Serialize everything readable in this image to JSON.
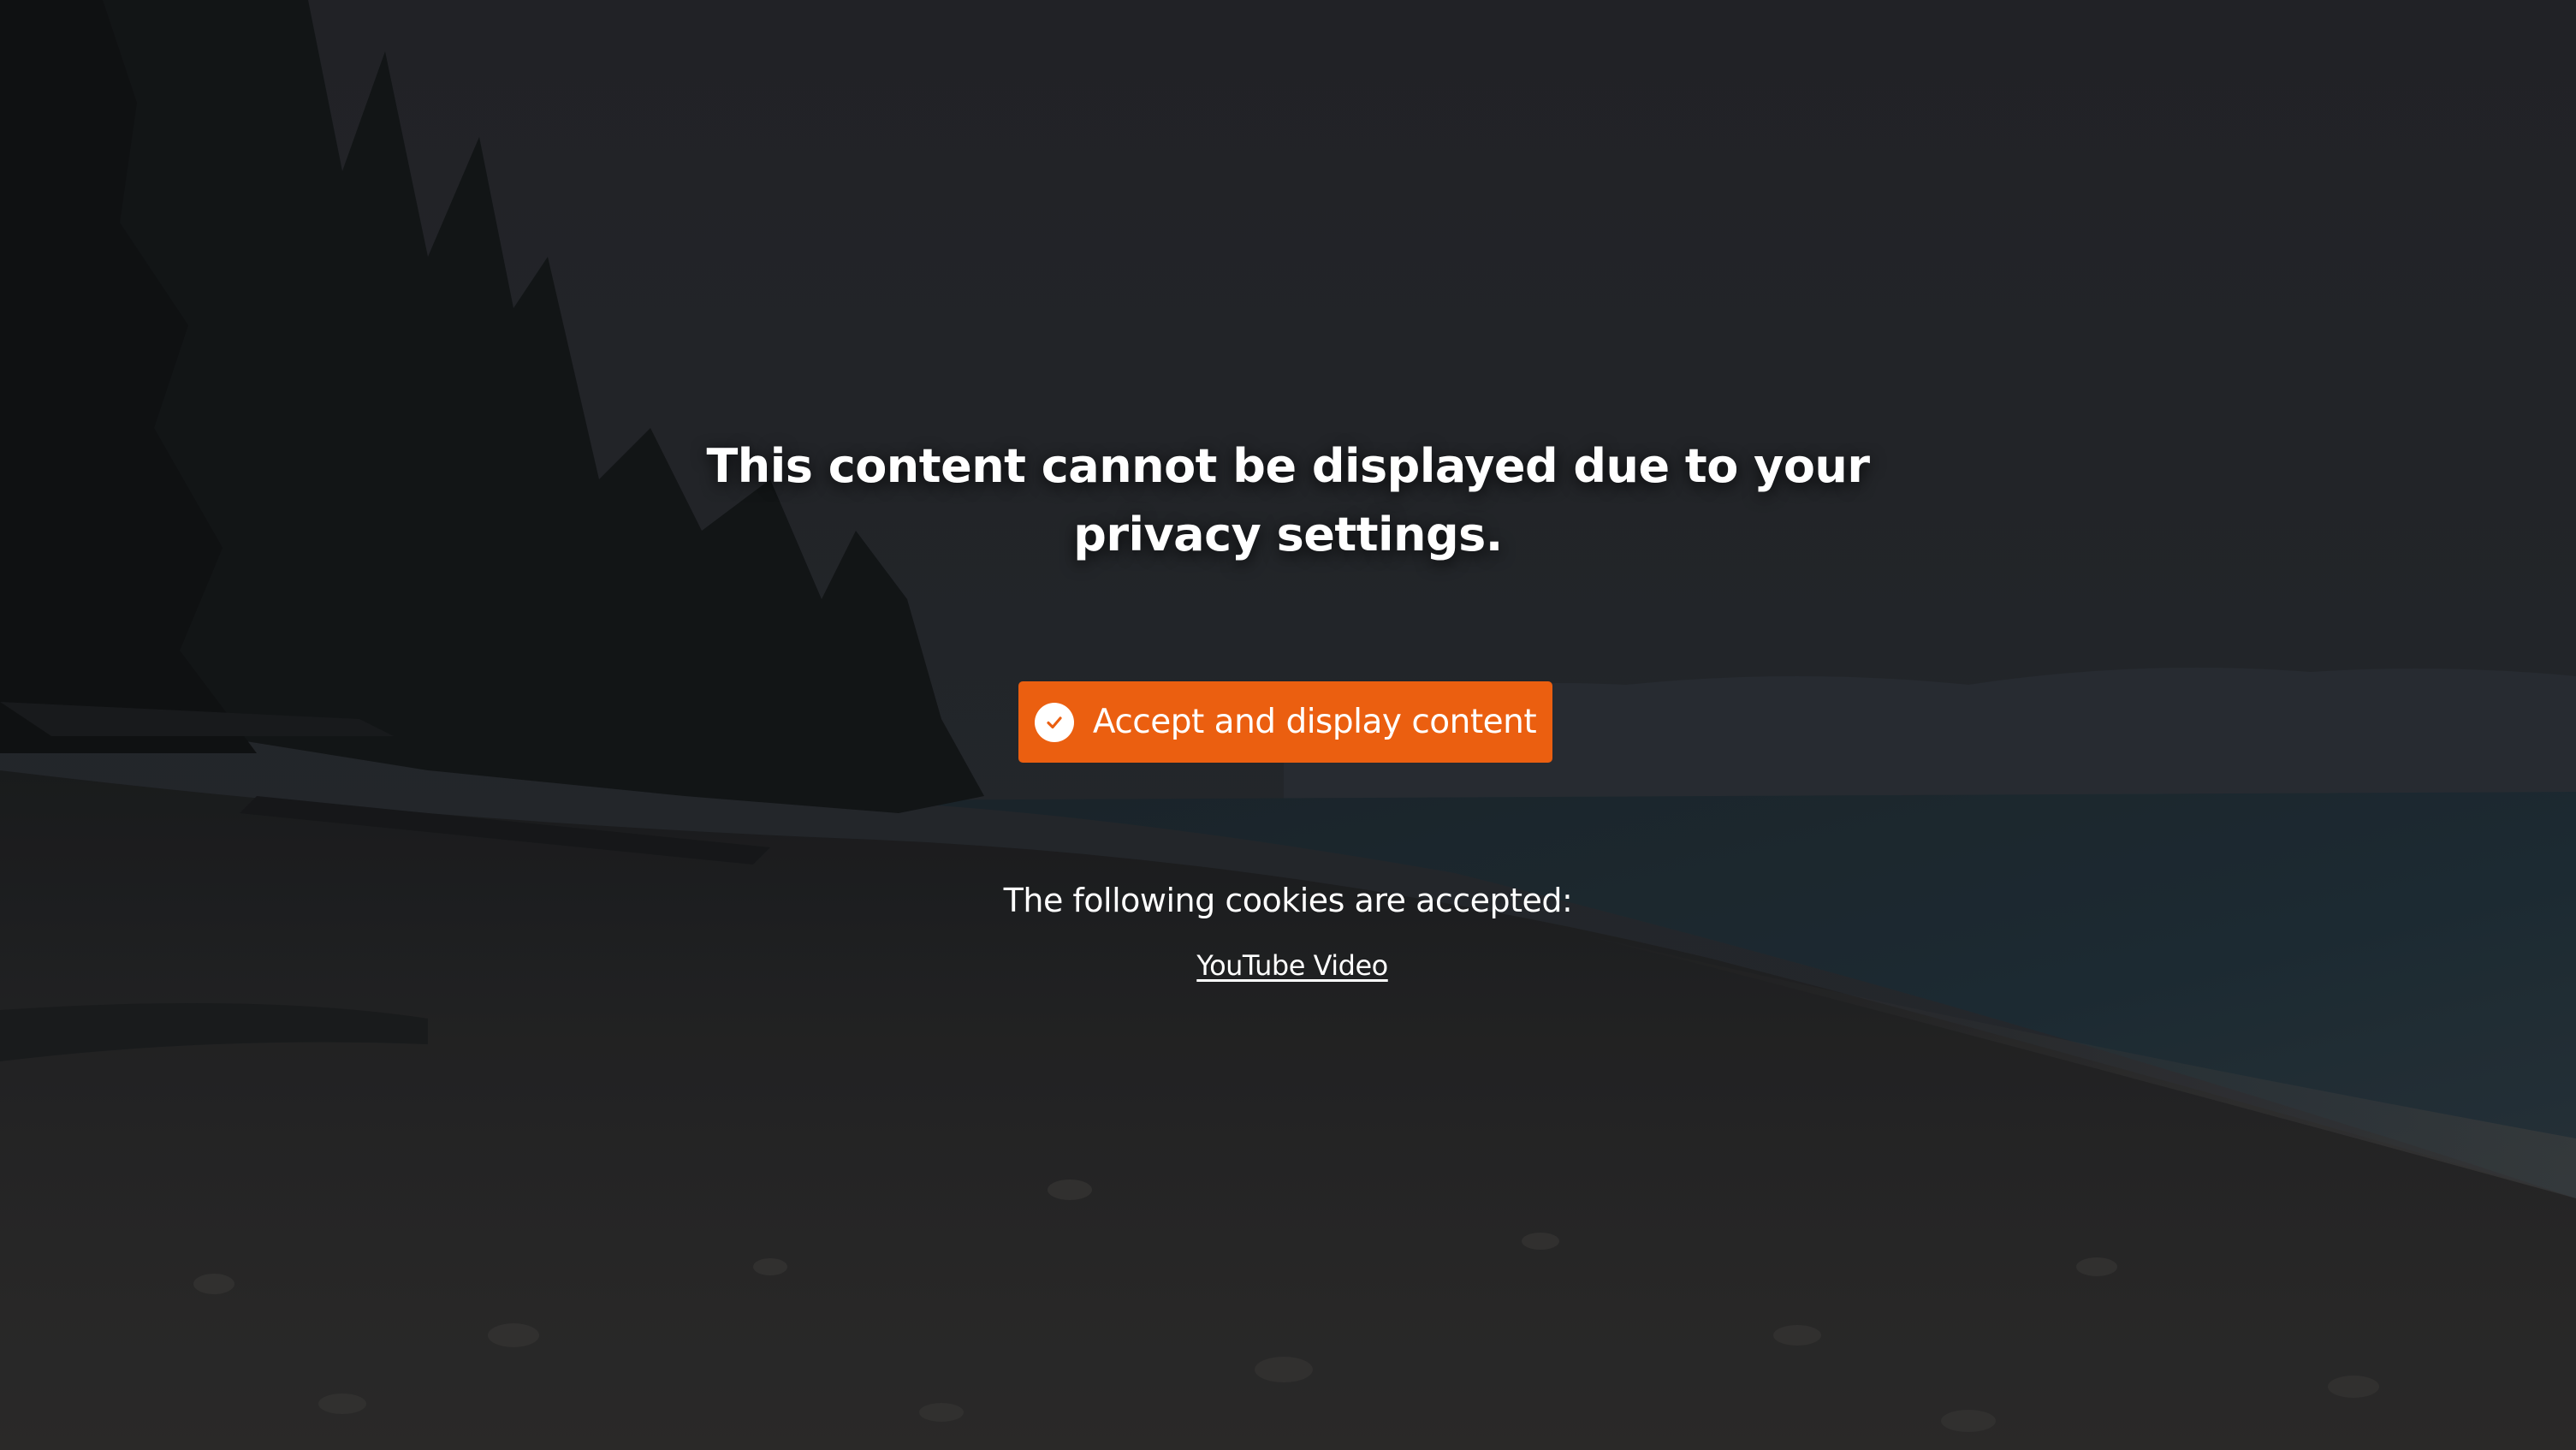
{
  "overlay": {
    "message": "This content cannot be displayed due to your privacy settings.",
    "accept_button_label": "Accept and display content",
    "accept_button_icon": "check-circle-icon",
    "cookies_label": "The following cookies are accepted:",
    "cookie_links": [
      "YouTube Video"
    ]
  },
  "colors": {
    "accent": "#eb5f10",
    "text": "#ffffff",
    "background_dim": "#26292d"
  }
}
